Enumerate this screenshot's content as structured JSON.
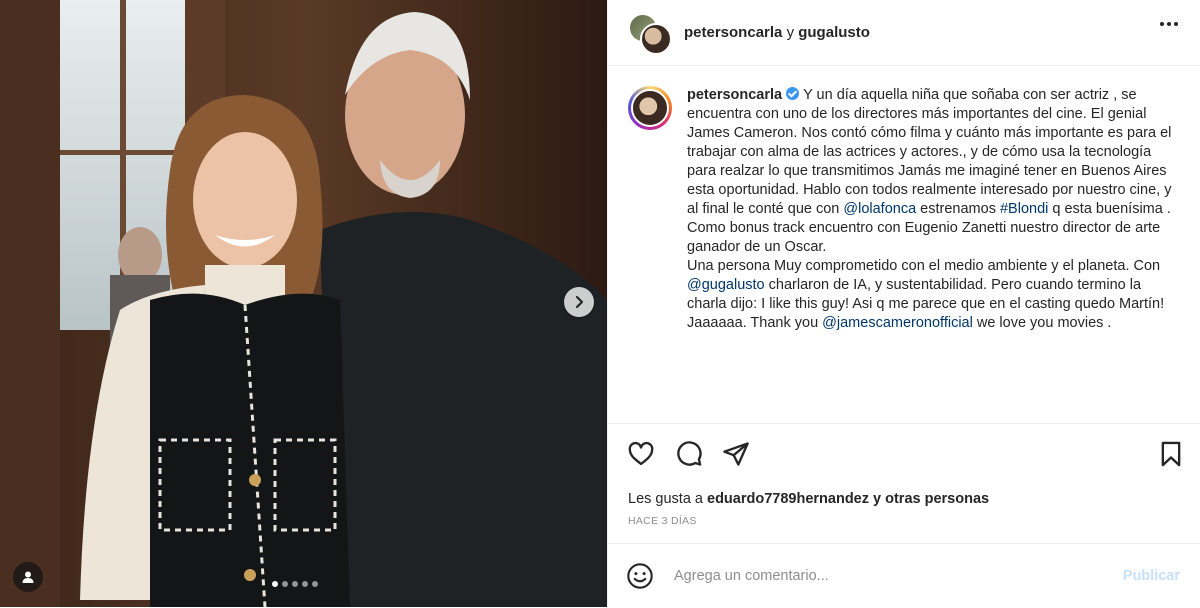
{
  "post": {
    "header": {
      "user1": "petersoncarla",
      "joiner": "y",
      "user2": "gugalusto"
    },
    "caption": {
      "username": "petersoncarla",
      "t1": "Y un día aquella niña que soñaba con ser actriz , se encuentra con uno de los directores más importantes del cine. El genial James Cameron. Nos contó cómo filma y cuánto más importante es para el trabajar con alma de las actrices y actores., y de cómo usa la tecnología para realzar lo que transmitimos Jamás me imaginé tener en Buenos Aires esta oportunidad. Hablo con todos realmente interesado por nuestro cine, y al final le conté que con ",
      "m1": "@lolafonca",
      "t2": " estrenamos ",
      "h1": "#Blondi",
      "t3": " q esta buenísima . Como bonus track encuentro con Eugenio Zanetti nuestro director de arte ganador de un Oscar.\nUna persona Muy comprometido con el medio ambiente y el planeta. Con ",
      "m2": "@gugalusto",
      "t4": " charlaron de IA, y sustentabilidad. Pero cuando termino la charla dijo: I like this guy! Asi q me parece que en el casting quedo Martín! Jaaaaaa. Thank you ",
      "m3": "@jamescameronofficial",
      "t5": " we love you movies ."
    },
    "likes": {
      "prefix": "Les gusta a",
      "user": "eduardo7789hernandez",
      "suffix": "y otras personas"
    },
    "time": "HACE 3 DÍAS",
    "comment": {
      "placeholder": "Agrega un comentario...",
      "publish": "Publicar"
    },
    "carousel": {
      "count": 5,
      "active": 1
    },
    "icons": [
      "heart-icon",
      "comment-icon",
      "share-icon",
      "bookmark-icon",
      "emoji-icon",
      "more-icon",
      "chevron-right-icon",
      "user-tag-icon"
    ],
    "colors": {
      "link": "#00376b",
      "verified": "#3897f0",
      "publish_disabled": "#c7e0fd"
    }
  }
}
